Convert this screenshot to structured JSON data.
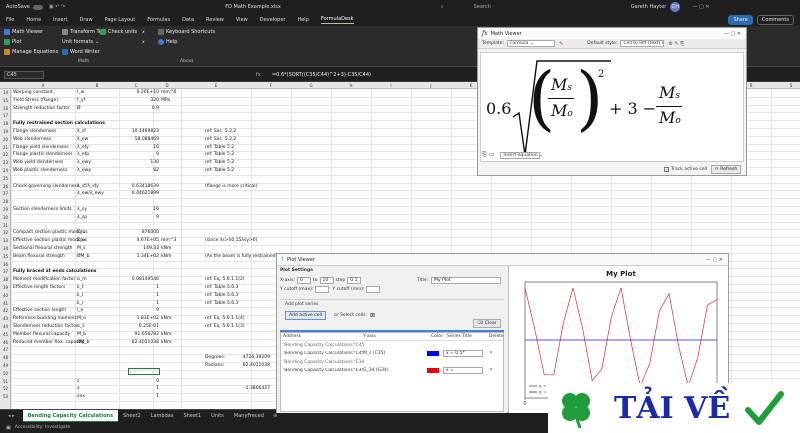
{
  "titlebar": {
    "autosave": "AutoSave",
    "filename": "FD Math Example.xlsx",
    "search_placeholder": "Search",
    "user": "Gareth Hayter",
    "initials": "GH"
  },
  "menu": {
    "items": [
      "File",
      "Home",
      "Insert",
      "Draw",
      "Page Layout",
      "Formulas",
      "Data",
      "Review",
      "View",
      "Developer",
      "Help",
      "FormulaDesk"
    ],
    "share": "Share",
    "comments": "Comments"
  },
  "ribbon": {
    "math_viewer": "Math Viewer",
    "plot": "Plot",
    "manage_equations": "Manage Equations",
    "transform_text": "Transform Text",
    "check_units": "Check units",
    "unit_formats": "Unit formats",
    "word_writer": "Word Writer",
    "keyboard_shortcuts": "Keyboard Shortcuts",
    "help": "Help",
    "group_math": "Math",
    "group_about": "About"
  },
  "formula_bar": {
    "namebox": "C45",
    "formula": "=0.6*(SQRT((C35/C44)^2+3)-C35/C44)"
  },
  "sheet": {
    "columns": [
      "A",
      "B",
      "C",
      "D",
      "E",
      "F",
      "G",
      "H",
      "I",
      "J",
      "K",
      "L",
      "M",
      "N",
      "O",
      "P",
      "Q",
      "R",
      "S"
    ],
    "rows": [
      {
        "n": "14",
        "a": "Warping constant",
        "b": "I_w",
        "c": "9.20E+10",
        "d": "mm^6",
        "e": ""
      },
      {
        "n": "15",
        "a": "Yield Stress (flange)",
        "b": "f_yf",
        "c": "320",
        "d": "MPa",
        "e": ""
      },
      {
        "n": "16",
        "a": "Strength reduction factor",
        "b": "Ø",
        "c": "0.9",
        "d": "",
        "e": ""
      },
      {
        "n": "17",
        "a": "",
        "b": "",
        "c": "",
        "d": "",
        "e": ""
      },
      {
        "n": "18",
        "a": "Fully restrained section calculations",
        "b": "",
        "c": "",
        "d": "",
        "e": "",
        "bold": true
      },
      {
        "n": "19",
        "a": "Flange slenderness",
        "b": "λ_sf",
        "c": "10.1469823",
        "d": "",
        "e": "ref: Sec. 5.2.2"
      },
      {
        "n": "20",
        "a": "Web slenderness",
        "b": "λ_ew",
        "c": "58.088469",
        "d": "",
        "e": "ref: Sec. 5.2.2"
      },
      {
        "n": "21",
        "a": "Flange yield slenderness",
        "b": "λ_efy",
        "c": "16",
        "d": "",
        "e": "ref: Table 5.2"
      },
      {
        "n": "22",
        "a": "Flange plastic slenderness",
        "b": "λ_efp",
        "c": "9",
        "d": "",
        "e": "ref: Table 5.2"
      },
      {
        "n": "23",
        "a": "Web yield slenderness",
        "b": "λ_ewy",
        "c": "130",
        "d": "",
        "e": "ref: Table 5.2"
      },
      {
        "n": "24",
        "a": "Web plastic slenderness",
        "b": "λ_ewp",
        "c": "82",
        "d": "",
        "e": "ref: Table 5.2"
      },
      {
        "n": "25",
        "a": "",
        "b": "",
        "c": "",
        "d": "",
        "e": ""
      },
      {
        "n": "26",
        "a": "Check governing slenderness",
        "b": "λ_sf/λ_sfy",
        "c": "0.63418639",
        "d": "",
        "e": "(flange is more critical)"
      },
      {
        "n": "27",
        "a": "",
        "b": "λ_ew/λ_ewy",
        "c": "0.44621899",
        "d": "",
        "e": ""
      },
      {
        "n": "28",
        "a": "",
        "b": "",
        "c": "",
        "d": "",
        "e": ""
      },
      {
        "n": "29",
        "a": "Section slenderness limits",
        "b": "λ_sy",
        "c": "16",
        "d": "",
        "e": ""
      },
      {
        "n": "30",
        "a": "",
        "b": "λ_sp",
        "c": "9",
        "d": "",
        "e": ""
      },
      {
        "n": "31",
        "a": "",
        "b": "",
        "c": "",
        "d": "",
        "e": ""
      },
      {
        "n": "32",
        "a": "Compact section plastic modulus",
        "b": "Z_c",
        "c": "876000",
        "d": "",
        "e": ""
      },
      {
        "n": "33",
        "a": "Effective section plastic modulus",
        "b": "Z_e",
        "c": "4.67E+05",
        "d": "mm^3",
        "e": "(since λs>λ0.15λsy>0)"
      },
      {
        "n": "34",
        "a": "Sectional flexural strength",
        "b": "M_s",
        "c": "149.33",
        "d": "kNm",
        "e": ""
      },
      {
        "n": "35",
        "a": "Beam flexural strength",
        "b": "ØM_b",
        "c": "1.34E+02",
        "d": "kNm",
        "e": "(As the beam is fully restrained)"
      },
      {
        "n": "36",
        "a": "",
        "b": "",
        "c": "",
        "d": "",
        "e": ""
      },
      {
        "n": "37",
        "a": "Fully braced at ends calculations",
        "b": "",
        "c": "",
        "d": "",
        "e": "",
        "bold": true
      },
      {
        "n": "38",
        "a": "Moment modification factor",
        "b": "α_m",
        "c": "0.08149546",
        "d": "",
        "e": "ref: Eq. 5.6.1.1(2)"
      },
      {
        "n": "39",
        "a": "Effective length factors",
        "b": "k_t",
        "c": "1",
        "d": "",
        "e": "ref: Table 5.6.3"
      },
      {
        "n": "40",
        "a": "",
        "b": "k_l",
        "c": "1",
        "d": "",
        "e": "ref: Table 5.6.3"
      },
      {
        "n": "41",
        "a": "",
        "b": "k_r",
        "c": "1",
        "d": "",
        "e": "ref: Table 5.6.3"
      },
      {
        "n": "42",
        "a": "Effective section length",
        "b": "l_e",
        "c": "9",
        "d": "",
        "e": ""
      },
      {
        "n": "43",
        "a": "Reference buckling moment",
        "b": "M_o",
        "c": "1.83E+02",
        "d": "kNm",
        "e": "ref: Eq. 5.6.1.1(4)"
      },
      {
        "n": "44",
        "a": "Slenderness reduction factor",
        "b": "α_s",
        "c": "6.25E-01",
        "d": "",
        "e": "ref: Eq. 5.6.1.1(3)"
      },
      {
        "n": "45",
        "a": "Member flexural capacity",
        "b": "M_b",
        "c": "91.656782",
        "d": "kNm",
        "e": ""
      },
      {
        "n": "46",
        "a": "Reduced member flex. capacity",
        "b": "ØM_b",
        "c": "82.4011038",
        "d": "kNm",
        "e": ""
      },
      {
        "n": "47",
        "a": "",
        "b": "",
        "c": "",
        "d": "",
        "e": ""
      },
      {
        "n": "48",
        "a": "",
        "b": "",
        "c": "",
        "d": "",
        "e": "Degrees:"
      },
      {
        "n": "49",
        "a": "",
        "b": "",
        "c": "",
        "d": "",
        "e": "Radians:"
      },
      {
        "n": "50",
        "a": "",
        "b": "",
        "c": "",
        "d": "",
        "e": ""
      },
      {
        "n": "51",
        "a": "",
        "b": "z",
        "c": "0",
        "d": "",
        "e": ""
      },
      {
        "n": "52",
        "a": "",
        "b": "x",
        "c": "1",
        "d": "",
        "e": ""
      },
      {
        "n": "53",
        "a": "",
        "b": "xxx",
        "c": "1",
        "d": "",
        "e": ""
      }
    ],
    "extra_values": {
      "degrees": "4726.39209",
      "radians": "82.4011038",
      "neg": "-1.3806427"
    }
  },
  "tabs": [
    "Bending Capacity Calculations",
    "Sheet2",
    "Lambdas",
    "Sheet1",
    "Units",
    "ManyFreced"
  ],
  "status": {
    "left": "Accessibility: Investigate",
    "right": "Display settings"
  },
  "math_viewer": {
    "title": "Math Viewer",
    "template_label": "Template:",
    "template_value": "Formula",
    "default_style_label": "Default style:",
    "default_style_value": "Cell to left (text) cells",
    "insert_equation": "Insert equation",
    "track_active_cell": "Track active cell",
    "refresh": "Refresh",
    "formula": {
      "coef": "0.6",
      "m": "M",
      "s": "s",
      "o": "o",
      "exp": "2",
      "plus": "+ 3 −"
    }
  },
  "plot_viewer": {
    "title": "Plot Viewer",
    "plot_settings": "Plot Settings",
    "x_axis_label": "X-axis:",
    "x_from": "0",
    "to_label": "to",
    "x_to": "10",
    "step_label": "step",
    "step": "0.1",
    "y_cutoff_max_label": "Y cutoff (max):",
    "y_cutoff_min_label": "Y cutoff (min):",
    "title_label": "Title:",
    "title_value": "My Plot",
    "add_series_label": "Add plot series",
    "add_active_cell": "Add active cell",
    "or_select_cells": "or Select cells:",
    "clear": "Clear",
    "table_headers": [
      "Address",
      "Y-axis",
      "Color",
      "Series Title",
      "Delete"
    ],
    "groups": [
      "'Bending Capacity Calculations'!C45",
      "'Bending Capacity Calculations'!E34"
    ],
    "series_rows": [
      {
        "address": "'Bending Capacity Calculations'!C45",
        "yaxis": "M_s (C35)",
        "color": "#0000ee",
        "title": "x = 0.5*(SQRT(...",
        "del": "✕"
      },
      {
        "address": "'Bending Capacity Calculations'!E34",
        "yaxis": "G_34 (G34)",
        "color": "#ee0000",
        "title": "x = SIN(x*TANCI8(...",
        "del": "✕"
      }
    ],
    "legend": [
      "x = 5th",
      "x = 0.6"
    ]
  },
  "chart_data": {
    "type": "line",
    "title": "My Plot",
    "xlim": [
      0,
      10
    ],
    "ylim": [
      -1,
      1
    ],
    "x_ticks": [
      0,
      2,
      4,
      6,
      8,
      10
    ],
    "series": [
      {
        "name": "x = 5th",
        "color": "#cc3333",
        "x": [
          0,
          0.5,
          1,
          1.5,
          2,
          2.5,
          3,
          3.5,
          4,
          4.5,
          5,
          5.5,
          6,
          6.5,
          7,
          7.5,
          8,
          8.5,
          9,
          9.5,
          10
        ],
        "y": [
          0.9,
          0.2,
          -0.6,
          -0.6,
          0.3,
          0.9,
          0.2,
          -0.7,
          -0.5,
          0.4,
          0.9,
          0.0,
          -0.8,
          -0.4,
          0.5,
          0.8,
          -0.1,
          -0.8,
          -0.3,
          0.6,
          0.7
        ]
      },
      {
        "name": "x = 0.6",
        "color": "#2222cc",
        "x": [
          0,
          10
        ],
        "y": [
          0,
          0
        ]
      }
    ]
  },
  "watermark": {
    "text": "TẢI VỀ"
  }
}
